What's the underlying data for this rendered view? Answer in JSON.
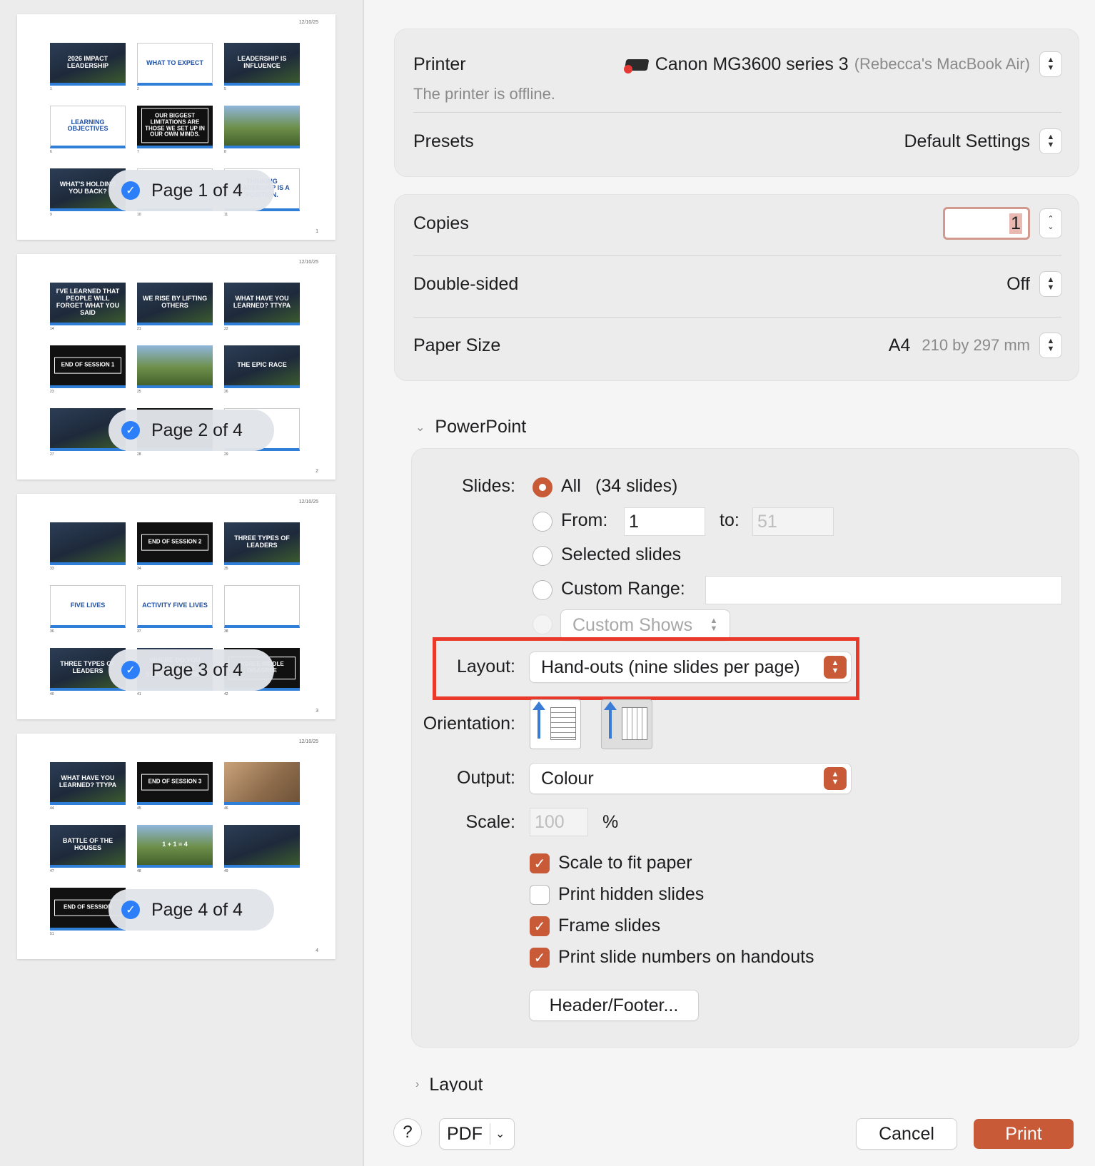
{
  "preview": {
    "pages": [
      {
        "label": "Page 1 of 4",
        "date": "12/10/25",
        "number": "1",
        "thumbs": [
          {
            "title": "2026 IMPACT LEADERSHIP",
            "num": "1",
            "style": "blue"
          },
          {
            "title": "WHAT TO EXPECT",
            "num": "2",
            "style": "white"
          },
          {
            "title": "LEADERSHIP IS INFLUENCE",
            "num": "5",
            "style": "blue"
          },
          {
            "title": "LEARNING OBJECTIVES",
            "num": "6",
            "style": "white"
          },
          {
            "title": "Our biggest limitations are those we set up in our own minds.",
            "num": "7",
            "style": "dark"
          },
          {
            "title": "",
            "num": "8",
            "style": "photo"
          },
          {
            "title": "WHAT'S HOLDING YOU BACK?",
            "num": "9",
            "style": "blue"
          },
          {
            "title": "",
            "num": "10",
            "style": "white"
          },
          {
            "title": "Thinking leadership is a position.",
            "num": "11",
            "style": "white"
          }
        ]
      },
      {
        "label": "Page 2 of 4",
        "date": "12/10/25",
        "number": "2",
        "thumbs": [
          {
            "title": "I've learned that people will forget what you said",
            "num": "14",
            "style": "blue"
          },
          {
            "title": "WE RISE BY LIFTING OTHERS",
            "num": "21",
            "style": "blue"
          },
          {
            "title": "WHAT HAVE YOU LEARNED? TTYPA",
            "num": "22",
            "style": "blue"
          },
          {
            "title": "END OF SESSION 1",
            "num": "23",
            "style": "dark"
          },
          {
            "title": "",
            "num": "25",
            "style": "photo"
          },
          {
            "title": "THE EPIC RACE",
            "num": "26",
            "style": "blue"
          },
          {
            "title": "",
            "num": "27",
            "style": "blue"
          },
          {
            "title": "",
            "num": "28",
            "style": "dark"
          },
          {
            "title": "",
            "num": "29",
            "style": "white"
          }
        ]
      },
      {
        "label": "Page 3 of 4",
        "date": "12/10/25",
        "number": "3",
        "thumbs": [
          {
            "title": "",
            "num": "33",
            "style": "blue"
          },
          {
            "title": "END OF SESSION 2",
            "num": "34",
            "style": "dark"
          },
          {
            "title": "THREE TYPES OF LEADERS",
            "num": "35",
            "style": "blue"
          },
          {
            "title": "FIVE LIVES",
            "num": "36",
            "style": "white"
          },
          {
            "title": "ACTIVITY FIVE LIVES",
            "num": "37",
            "style": "white"
          },
          {
            "title": "",
            "num": "38",
            "style": "white"
          },
          {
            "title": "THREE TYPES OF LEADERS",
            "num": "40",
            "style": "blue"
          },
          {
            "title": "WHERE DO YOU THINK YOUR STRENGTHS ARE?",
            "num": "41",
            "style": "blue"
          },
          {
            "title": "AGREE MIDDLE DISAGREE",
            "num": "42",
            "style": "dark"
          }
        ]
      },
      {
        "label": "Page 4 of 4",
        "date": "12/10/25",
        "number": "4",
        "thumbs": [
          {
            "title": "WHAT HAVE YOU LEARNED? TTYPA",
            "num": "44",
            "style": "blue"
          },
          {
            "title": "END OF SESSION 3",
            "num": "45",
            "style": "dark"
          },
          {
            "title": "",
            "num": "46",
            "style": "sepia"
          },
          {
            "title": "BATTLE OF THE HOUSES",
            "num": "47",
            "style": "blue"
          },
          {
            "title": "1 + 1 = 4",
            "num": "48",
            "style": "photo"
          },
          {
            "title": "",
            "num": "49",
            "style": "blue"
          },
          {
            "title": "END OF SESSION",
            "num": "51",
            "style": "dark"
          }
        ]
      }
    ]
  },
  "printer": {
    "label": "Printer",
    "name": "Canon MG3600 series 3",
    "host": "(Rebecca's MacBook Air)",
    "status": "The printer is offline."
  },
  "presets": {
    "label": "Presets",
    "value": "Default Settings"
  },
  "copies": {
    "label": "Copies",
    "value": "1"
  },
  "double_sided": {
    "label": "Double-sided",
    "value": "Off"
  },
  "paper_size": {
    "label": "Paper Size",
    "value": "A4",
    "detail": "210 by 297 mm"
  },
  "powerpoint": {
    "section_label": "PowerPoint",
    "slides_label": "Slides:",
    "all_label": "All",
    "all_count": "(34 slides)",
    "from_label": "From:",
    "from_value": "1",
    "to_label": "to:",
    "to_value": "51",
    "selected_label": "Selected slides",
    "custom_range_label": "Custom Range:",
    "custom_shows_label": "Custom Shows",
    "layout_label": "Layout:",
    "layout_value": "Hand-outs (nine slides per page)",
    "orientation_label": "Orientation:",
    "output_label": "Output:",
    "output_value": "Colour",
    "scale_label": "Scale:",
    "scale_value": "100",
    "scale_unit": "%",
    "checks": {
      "scale_to_fit": "Scale to fit paper",
      "print_hidden": "Print hidden slides",
      "frame_slides": "Frame slides",
      "slide_numbers": "Print slide numbers on handouts"
    },
    "header_footer_button": "Header/Footer..."
  },
  "next_section_label": "Layout",
  "footer": {
    "help": "?",
    "pdf": "PDF",
    "cancel": "Cancel",
    "print": "Print"
  },
  "colors": {
    "accent": "#c85a38",
    "highlight": "#e8392a",
    "check_blue": "#2d7ff9"
  }
}
